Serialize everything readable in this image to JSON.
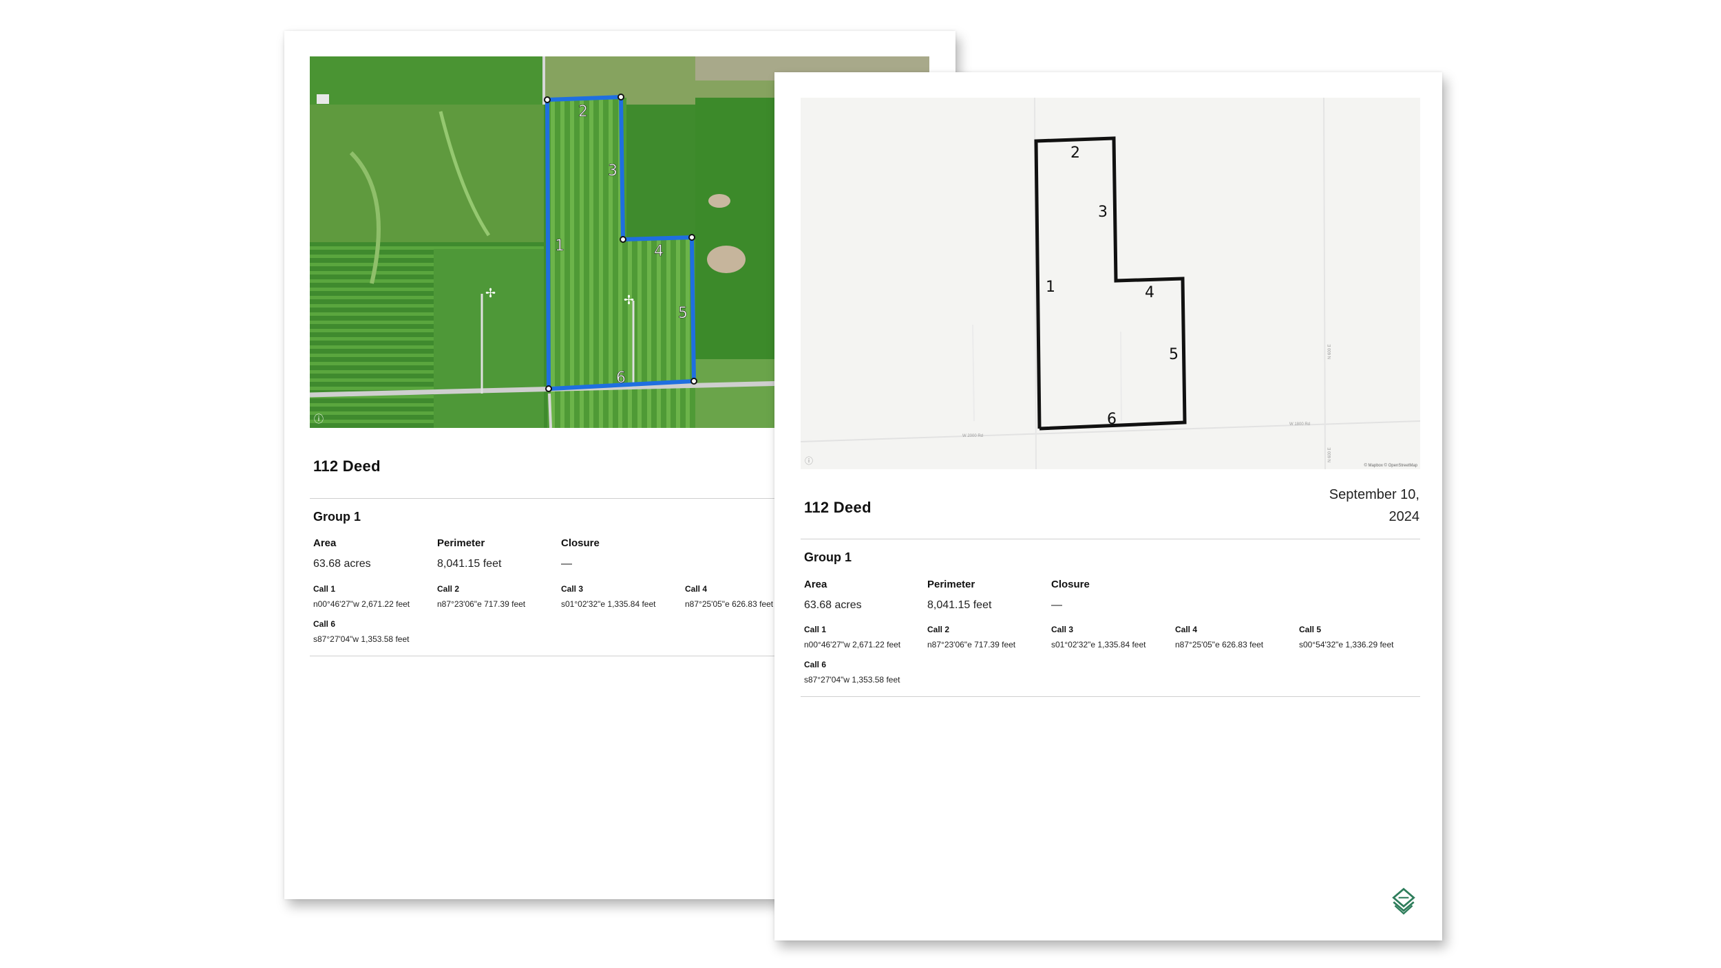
{
  "colors": {
    "boundary_satellite": "#1f6fe0",
    "boundary_street": "#111111",
    "brand_green": "#2e7d5b",
    "street_bg": "#f4f4f2"
  },
  "back_page": {
    "title": "112 Deed",
    "group": "Group 1",
    "area_label": "Area",
    "area_value": "63.68 acres",
    "perimeter_label": "Perimeter",
    "perimeter_value": "8,041.15 feet",
    "closure_label": "Closure",
    "closure_value": "—",
    "calls": [
      {
        "label": "Call 1",
        "value": "n00°46'27\"w 2,671.22 feet"
      },
      {
        "label": "Call 2",
        "value": "n87°23'06\"e 717.39 feet"
      },
      {
        "label": "Call 3",
        "value": "s01°02'32\"e 1,335.84 feet"
      },
      {
        "label": "Call 4",
        "value": "n87°25'05\"e 626.83 feet"
      },
      {
        "label": "Call 6",
        "value": "s87°27'04\"w 1,353.58 feet"
      }
    ],
    "map_call_numbers": [
      "1",
      "2",
      "3",
      "4",
      "5",
      "6"
    ]
  },
  "front_page": {
    "title": "112 Deed",
    "date_line1": "September 10,",
    "date_line2": "2024",
    "group": "Group 1",
    "area_label": "Area",
    "area_value": "63.68 acres",
    "perimeter_label": "Perimeter",
    "perimeter_value": "8,041.15 feet",
    "closure_label": "Closure",
    "closure_value": "—",
    "calls": [
      {
        "label": "Call 1",
        "value": "n00°46'27\"w 2,671.22 feet"
      },
      {
        "label": "Call 2",
        "value": "n87°23'06\"e 717.39 feet"
      },
      {
        "label": "Call 3",
        "value": "s01°02'32\"e 1,335.84 feet"
      },
      {
        "label": "Call 4",
        "value": "n87°25'05\"e 626.83 feet"
      },
      {
        "label": "Call 5",
        "value": "s00°54'32\"e 1,336.29 feet"
      },
      {
        "label": "Call 6",
        "value": "s87°27'04\"w 1,353.58 feet"
      }
    ],
    "map_call_numbers": [
      "1",
      "2",
      "3",
      "4",
      "5",
      "6"
    ],
    "map_attribution": "© Mapbox © OpenStreetMap",
    "road_labels": [
      "W 2000 Rd",
      "W 1800 Rd",
      "N 600 E",
      "N 600 E"
    ]
  },
  "icons": {
    "logo": "stacked-layers-icon",
    "map_info": "info-icon"
  }
}
